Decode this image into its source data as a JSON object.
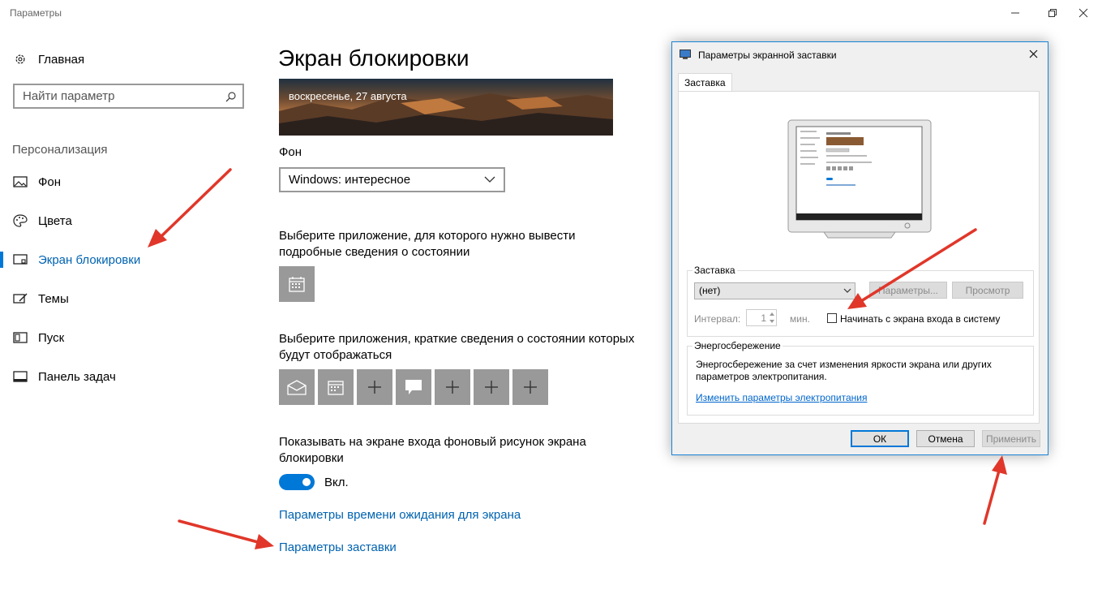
{
  "window": {
    "title": "Параметры"
  },
  "sidebar": {
    "home": "Главная",
    "search_placeholder": "Найти параметр",
    "section": "Персонализация",
    "items": [
      {
        "label": "Фон",
        "icon": "picture-icon"
      },
      {
        "label": "Цвета",
        "icon": "palette-icon"
      },
      {
        "label": "Экран блокировки",
        "icon": "lock-screen-icon",
        "active": true
      },
      {
        "label": "Темы",
        "icon": "themes-icon"
      },
      {
        "label": "Пуск",
        "icon": "start-icon"
      },
      {
        "label": "Панель задач",
        "icon": "taskbar-icon"
      }
    ]
  },
  "main": {
    "title": "Экран блокировки",
    "preview_date": "воскресенье, 27 августа",
    "background_label": "Фон",
    "background_value": "Windows: интересное",
    "detailed_app_label": "Выберите приложение, для которого нужно вывести подробные сведения о состоянии",
    "quick_apps_label": "Выберите приложения, краткие сведения о состоянии которых будут отображаться",
    "show_bg_label": "Показывать на экране входа фоновый рисунок экрана блокировки",
    "toggle_state": "Вкл.",
    "link_timeout": "Параметры времени ожидания для экрана",
    "link_screensaver": "Параметры заставки"
  },
  "dialog": {
    "title": "Параметры экранной заставки",
    "tab": "Заставка",
    "screensaver_group": "Заставка",
    "screensaver_value": "(нет)",
    "btn_settings": "Параметры...",
    "btn_preview": "Просмотр",
    "interval_label": "Интервал:",
    "interval_value": "1",
    "interval_unit": "мин.",
    "logon_checkbox": "Начинать с экрана входа в систему",
    "power_group": "Энергосбережение",
    "power_text": "Энергосбережение за счет изменения яркости экрана или других параметров электропитания.",
    "power_link": "Изменить параметры электропитания",
    "btn_ok": "ОК",
    "btn_cancel": "Отмена",
    "btn_apply": "Применить"
  },
  "colors": {
    "accent": "#0078d7",
    "link": "#0063b1",
    "arrow": "#e0372a"
  }
}
